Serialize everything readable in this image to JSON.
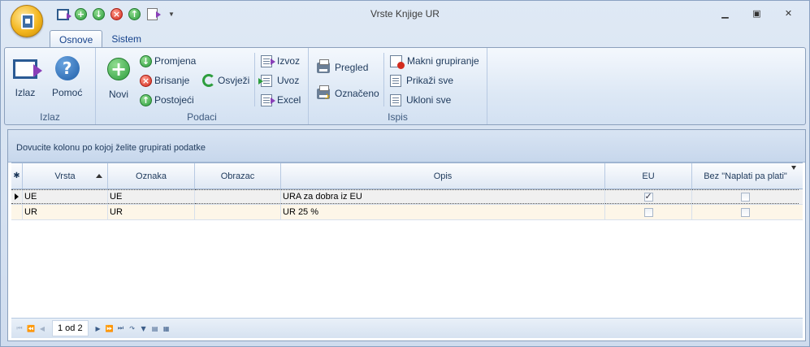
{
  "window": {
    "title": "Vrste Knjige UR"
  },
  "quick_access": [
    "exit-icon",
    "add-icon",
    "edit-icon",
    "delete-icon",
    "existing-icon",
    "export-icon"
  ],
  "tabs": [
    {
      "label": "Osnove",
      "active": true
    },
    {
      "label": "Sistem",
      "active": false
    }
  ],
  "ribbon": {
    "izlaz": {
      "group_label": "Izlaz",
      "exit_label": "Izlaz",
      "help_label": "Pomoć"
    },
    "podaci": {
      "group_label": "Podaci",
      "novi_label": "Novi",
      "promjena_label": "Promjena",
      "brisanje_label": "Brisanje",
      "postojeci_label": "Postojeći",
      "osvjezi_label": "Osvježi",
      "izvoz_label": "Izvoz",
      "uvoz_label": "Uvoz",
      "excel_label": "Excel"
    },
    "ispis": {
      "group_label": "Ispis",
      "pregled_label": "Pregled",
      "oznaceno_label": "Označeno",
      "makni_label": "Makni grupiranje",
      "prikazi_label": "Prikaži sve",
      "ukloni_label": "Ukloni sve"
    }
  },
  "grid": {
    "group_hint": "Dovucite kolonu po kojoj želite grupirati podatke",
    "columns": [
      "Vrsta",
      "Oznaka",
      "Obrazac",
      "Opis",
      "EU",
      "Bez \"Naplati pa plati\""
    ],
    "rows": [
      {
        "vrsta": "UE",
        "oznaka": "UE",
        "obrazac": "",
        "opis": "URA za dobra iz EU",
        "eu": true,
        "bez_naplati": false
      },
      {
        "vrsta": "UR",
        "oznaka": "UR",
        "obrazac": "",
        "opis": "UR 25 %",
        "eu": false,
        "bez_naplati": false
      }
    ]
  },
  "navigator": {
    "page_info": "1 od 2"
  },
  "colors": {
    "accent": "#15428b",
    "ribbon_bg": "#dde8f5",
    "selected_row": "#f0f0f0",
    "alt_row": "#fdf6e8"
  }
}
